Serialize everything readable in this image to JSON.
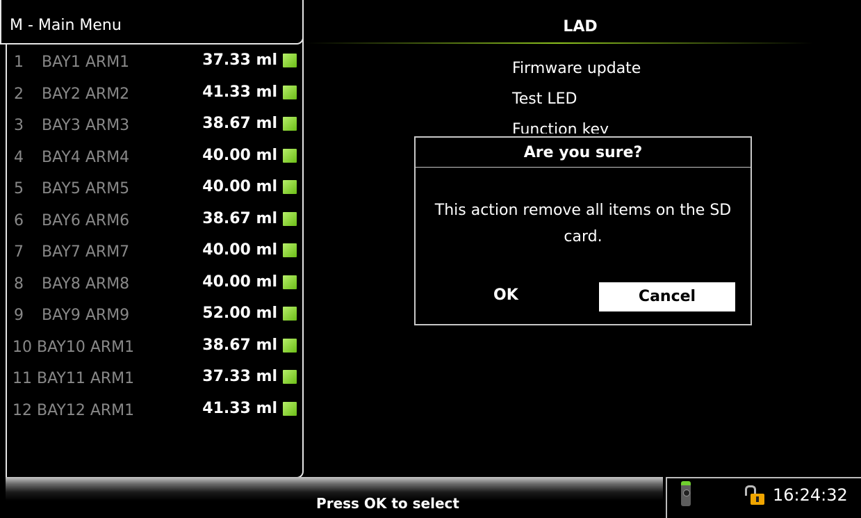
{
  "menu": {
    "title": "M - Main Menu"
  },
  "arms": [
    {
      "num": "1",
      "name": "BAY1 ARM1",
      "volume": "37.33 ml"
    },
    {
      "num": "2",
      "name": "BAY2 ARM2",
      "volume": "41.33 ml"
    },
    {
      "num": "3",
      "name": "BAY3 ARM3",
      "volume": "38.67 ml"
    },
    {
      "num": "4",
      "name": "BAY4 ARM4",
      "volume": "40.00 ml"
    },
    {
      "num": "5",
      "name": "BAY5 ARM5",
      "volume": "40.00 ml"
    },
    {
      "num": "6",
      "name": "BAY6 ARM6",
      "volume": "38.67 ml"
    },
    {
      "num": "7",
      "name": "BAY7 ARM7",
      "volume": "40.00 ml"
    },
    {
      "num": "8",
      "name": "BAY8 ARM8",
      "volume": "40.00 ml"
    },
    {
      "num": "9",
      "name": "BAY9 ARM9",
      "volume": "52.00 ml"
    },
    {
      "num": "",
      "name": "10 BAY10 ARM1",
      "volume": "38.67 ml"
    },
    {
      "num": "",
      "name": "11 BAY11 ARM1",
      "volume": "37.33 ml"
    },
    {
      "num": "",
      "name": "12 BAY12 ARM1",
      "volume": "41.33 ml"
    }
  ],
  "panel": {
    "title": "LAD",
    "options": [
      "Firmware update",
      "Test LED",
      "Function key"
    ]
  },
  "dialog": {
    "title": "Are you sure?",
    "message_line1": "This action remove all items on the SD",
    "message_line2": "card.",
    "ok_label": "OK",
    "cancel_label": "Cancel"
  },
  "status": {
    "hint": "Press OK to select",
    "time": "16:24:32"
  },
  "colors": {
    "accent": "#8dc21f",
    "led_ok": "#8ed43a",
    "lock": "#f0a500"
  },
  "icons": [
    "remote-control-icon",
    "unlocked-padlock-icon",
    "status-led-icon"
  ]
}
